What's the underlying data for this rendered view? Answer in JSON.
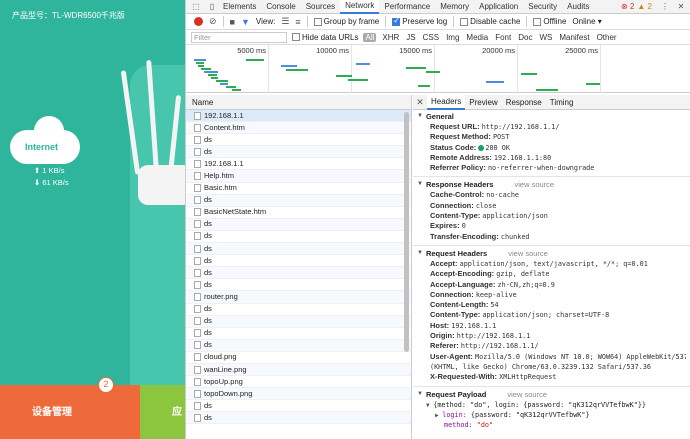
{
  "router": {
    "product": "产品型号：TL-WDR6500千兆版",
    "cloud_label": "Internet",
    "speed_up": "1 KB/s",
    "speed_down": "61 KB/s",
    "device_mgmt": "设备管理",
    "device_badge": "2",
    "next_tile": "应"
  },
  "devtools": {
    "tabs": [
      "Elements",
      "Console",
      "Sources",
      "Network",
      "Performance",
      "Memory",
      "Application",
      "Security",
      "Audits"
    ],
    "active_tab": "Network",
    "errors": "2",
    "warnings": "2",
    "toolbar": {
      "view_label": "View:",
      "group_by_frame": "Group by frame",
      "preserve_log": "Preserve log",
      "disable_cache": "Disable cache",
      "offline": "Offline",
      "online": "Online"
    },
    "filter": {
      "placeholder": "Filter",
      "hide_data_urls": "Hide data URLs",
      "types": [
        "All",
        "XHR",
        "JS",
        "CSS",
        "Img",
        "Media",
        "Font",
        "Doc",
        "WS",
        "Manifest",
        "Other"
      ]
    },
    "timeline_ticks": [
      "5000 ms",
      "10000 ms",
      "15000 ms",
      "20000 ms",
      "25000 ms"
    ],
    "list_header": "Name",
    "requests": [
      "192.168.1.1",
      "Content.htm",
      "ds",
      "ds",
      "192.168.1.1",
      "Help.htm",
      "Basic.htm",
      "ds",
      "BasicNetState.htm",
      "ds",
      "ds",
      "ds",
      "ds",
      "ds",
      "ds",
      "router.png",
      "ds",
      "ds",
      "ds",
      "ds",
      "cloud.png",
      "wanLine.png",
      "topoUp.png",
      "topoDown.png",
      "ds",
      "ds"
    ],
    "detail_tabs": [
      "Headers",
      "Preview",
      "Response",
      "Timing"
    ],
    "general": {
      "title": "General",
      "rows": [
        {
          "k": "Request URL:",
          "v": "http://192.168.1.1/"
        },
        {
          "k": "Request Method:",
          "v": "POST"
        },
        {
          "k": "Status Code:",
          "v": "200 OK"
        },
        {
          "k": "Remote Address:",
          "v": "192.168.1.1:80"
        },
        {
          "k": "Referrer Policy:",
          "v": "no-referrer-when-downgrade"
        }
      ]
    },
    "response_headers": {
      "title": "Response Headers",
      "view_source": "view source",
      "rows": [
        {
          "k": "Cache-Control:",
          "v": "no-cache"
        },
        {
          "k": "Connection:",
          "v": "close"
        },
        {
          "k": "Content-Type:",
          "v": "application/json"
        },
        {
          "k": "Expires:",
          "v": "0"
        },
        {
          "k": "Transfer-Encoding:",
          "v": "chunked"
        }
      ]
    },
    "request_headers": {
      "title": "Request Headers",
      "view_source": "view source",
      "rows": [
        {
          "k": "Accept:",
          "v": "application/json, text/javascript, */*; q=0.01"
        },
        {
          "k": "Accept-Encoding:",
          "v": "gzip, deflate"
        },
        {
          "k": "Accept-Language:",
          "v": "zh-CN,zh;q=0.9"
        },
        {
          "k": "Connection:",
          "v": "keep-alive"
        },
        {
          "k": "Content-Length:",
          "v": "54"
        },
        {
          "k": "Content-Type:",
          "v": "application/json; charset=UTF-8"
        },
        {
          "k": "Host:",
          "v": "192.168.1.1"
        },
        {
          "k": "Origin:",
          "v": "http://192.168.1.1"
        },
        {
          "k": "Referer:",
          "v": "http://192.168.1.1/"
        },
        {
          "k": "User-Agent:",
          "v": "Mozilla/5.0 (Windows NT 10.0; WOW64) AppleWebKit/537.36"
        },
        {
          "k": "",
          "v": "(KHTML, like Gecko) Chrome/63.0.3239.132 Safari/537.36"
        },
        {
          "k": "X-Requested-With:",
          "v": "XMLHttpRequest"
        }
      ]
    },
    "payload": {
      "title": "Request Payload",
      "view_source": "view source",
      "line1": "{method: \"do\", login: {password: \"qK312qrVVTefbwK\"}}",
      "line2_key": "login:",
      "line2_val": "{password: \"qK312qrVVTefbwK\"}",
      "line3_key": "method:",
      "line3_val": "\"do\""
    },
    "colors": {
      "accent": "#3879d9",
      "record": "#d93025",
      "router_green": "#2fb59b",
      "mgmt_orange": "#ef6a3a"
    }
  }
}
